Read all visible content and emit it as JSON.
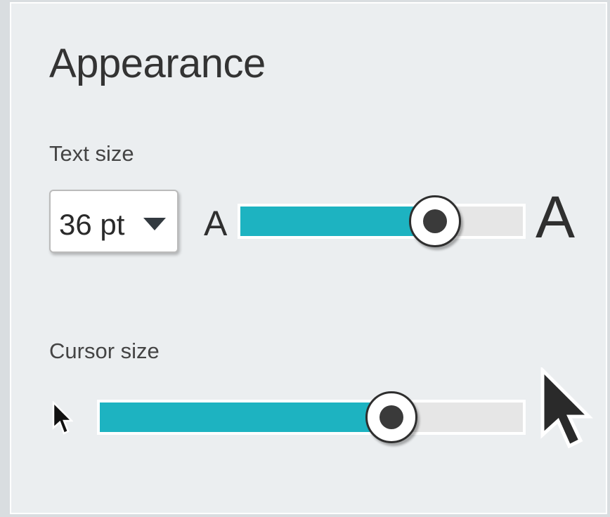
{
  "appearance": {
    "title": "Appearance",
    "text_size": {
      "label": "Text size",
      "selected": "36 pt",
      "small_glyph": "A",
      "large_glyph": "A",
      "slider_level_percent": 69
    },
    "cursor_size": {
      "label": "Cursor size",
      "slider_level_percent": 69
    }
  },
  "colors": {
    "panel_background": "#ebeef0",
    "slider_fill": "#1db3c1",
    "slider_track": "#e6e6e6"
  },
  "icons": {
    "dropdown": "caret-down-icon",
    "cursor_small": "cursor-small-icon",
    "cursor_large": "cursor-large-icon"
  }
}
